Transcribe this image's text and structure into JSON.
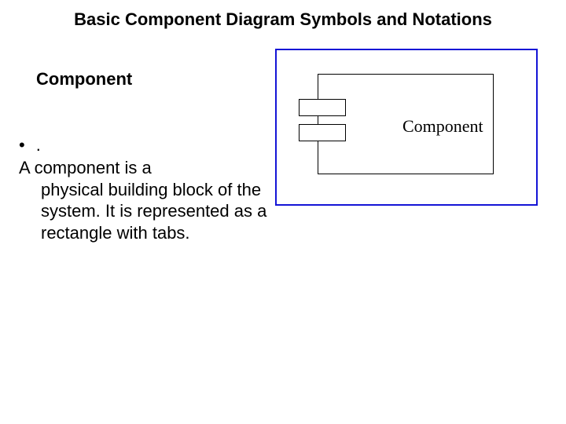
{
  "title": "Basic Component Diagram Symbols and Notations",
  "subtitle": "Component",
  "bullet": ".",
  "body": {
    "line1": "A component is a",
    "rest": "physical building block of the system. It is represented as a rectangle with tabs."
  },
  "diagram": {
    "label": "Component"
  }
}
